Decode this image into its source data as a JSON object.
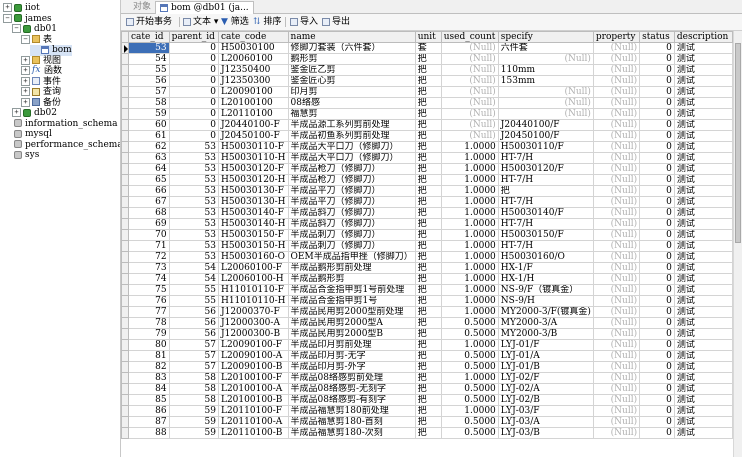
{
  "tree": [
    {
      "label": "iiot",
      "toggle": "⊞",
      "icon": "db",
      "indent": 0,
      "name": "tree-db-iiot"
    },
    {
      "label": "james",
      "toggle": "⊟",
      "icon": "db",
      "indent": 0,
      "name": "tree-db-james"
    },
    {
      "label": "db01",
      "toggle": "⊟",
      "icon": "db",
      "indent": 1,
      "name": "tree-db-db01"
    },
    {
      "label": "表",
      "toggle": "⊟",
      "icon": "folder",
      "indent": 2,
      "name": "tree-tables-folder"
    },
    {
      "label": "bom",
      "toggle": "",
      "icon": "table",
      "indent": 3,
      "name": "tree-table-bom",
      "selected": true
    },
    {
      "label": "视图",
      "toggle": "⊞",
      "icon": "folder",
      "indent": 2,
      "name": "tree-views"
    },
    {
      "label": "函数",
      "toggle": "⊞",
      "icon": "fx",
      "indent": 2,
      "name": "tree-functions"
    },
    {
      "label": "事件",
      "toggle": "⊞",
      "icon": "event",
      "indent": 2,
      "name": "tree-events"
    },
    {
      "label": "查询",
      "toggle": "⊞",
      "icon": "query",
      "indent": 2,
      "name": "tree-queries"
    },
    {
      "label": "备份",
      "toggle": "⊞",
      "icon": "backup",
      "indent": 2,
      "name": "tree-backups"
    },
    {
      "label": "db02",
      "toggle": "⊞",
      "icon": "db",
      "indent": 1,
      "name": "tree-db-db02"
    },
    {
      "label": "information_schema",
      "toggle": "",
      "icon": "dbgray",
      "indent": 0,
      "name": "tree-db-information-schema"
    },
    {
      "label": "mysql",
      "toggle": "",
      "icon": "dbgray",
      "indent": 0,
      "name": "tree-db-mysql"
    },
    {
      "label": "performance_schema",
      "toggle": "",
      "icon": "dbgray",
      "indent": 0,
      "name": "tree-db-performance-schema"
    },
    {
      "label": "sys",
      "toggle": "",
      "icon": "dbgray",
      "indent": 0,
      "name": "tree-db-sys"
    }
  ],
  "tabs": {
    "objects": "对象",
    "bom": "bom @db01 (ja..."
  },
  "toolbar": {
    "begin_transaction": "开始事务",
    "text": "文本",
    "filter": "筛选",
    "sort": "排序",
    "import": "导入",
    "export": "导出"
  },
  "columns": [
    "cate_id",
    "parent_id",
    "cate_code",
    "name",
    "unit",
    "used_count",
    "specify",
    "property",
    "status",
    "description"
  ],
  "null_text": "(Null)",
  "rows": [
    [
      "53",
      "0",
      "H50030100",
      "修脚刀套装（六件套）",
      "套",
      null,
      "六件套",
      null,
      "0",
      "测试"
    ],
    [
      "54",
      "0",
      "L20060100",
      "鹅形剪",
      "把",
      null,
      null,
      null,
      "0",
      "测试"
    ],
    [
      "55",
      "0",
      "J12350400",
      "鉴金匠乙剪",
      "把",
      null,
      "110mm",
      null,
      "0",
      "测试"
    ],
    [
      "56",
      "0",
      "J12350300",
      "鉴金匠心剪",
      "把",
      null,
      "153mm",
      null,
      "0",
      "测试"
    ],
    [
      "57",
      "0",
      "L20090100",
      "印月剪",
      "把",
      null,
      null,
      null,
      "0",
      "测试"
    ],
    [
      "58",
      "0",
      "L20100100",
      "08络感",
      "把",
      null,
      null,
      null,
      "0",
      "测试"
    ],
    [
      "59",
      "0",
      "L20110100",
      "福慧剪",
      "把",
      null,
      null,
      null,
      "0",
      "测试"
    ],
    [
      "60",
      "0",
      "J20440100-F",
      "半成品源工系列剪前处理",
      "把",
      null,
      "J20440100/F",
      null,
      "0",
      "测试"
    ],
    [
      "61",
      "0",
      "J20450100-F",
      "半成品初鱼系列剪前处理",
      "把",
      null,
      "J20450100/F",
      null,
      "0",
      "测试"
    ],
    [
      "62",
      "53",
      "H50030110-F",
      "半成品大平口刀（修脚刀）",
      "把",
      "1.0000",
      "H50030110/F",
      null,
      "0",
      "测试"
    ],
    [
      "63",
      "53",
      "H50030110-H",
      "半成品大平口刀（修脚刀）",
      "把",
      "1.0000",
      "HT-7/H",
      null,
      "0",
      "测试"
    ],
    [
      "64",
      "53",
      "H50030120-F",
      "半成品枪刀（修脚刀）",
      "把",
      "1.0000",
      "H50030120/F",
      null,
      "0",
      "测试"
    ],
    [
      "65",
      "53",
      "H50030120-H",
      "半成品枪刀（修脚刀）",
      "把",
      "1.0000",
      "HT-7/H",
      null,
      "0",
      "测试"
    ],
    [
      "66",
      "53",
      "H50030130-F",
      "半成品平刀（修脚刀）",
      "把",
      "1.0000",
      "把",
      null,
      "0",
      "测试"
    ],
    [
      "67",
      "53",
      "H50030130-H",
      "半成品平刀（修脚刀）",
      "把",
      "1.0000",
      "HT-7/H",
      null,
      "0",
      "测试"
    ],
    [
      "68",
      "53",
      "H50030140-F",
      "半成品斜刀（修脚刀）",
      "把",
      "1.0000",
      "H50030140/F",
      null,
      "0",
      "测试"
    ],
    [
      "69",
      "53",
      "H50030140-H",
      "半成品斜刀（修脚刀）",
      "把",
      "1.0000",
      "HT-7/H",
      null,
      "0",
      "测试"
    ],
    [
      "70",
      "53",
      "H50030150-F",
      "半成品刺刀（修脚刀）",
      "把",
      "1.0000",
      "H50030150/F",
      null,
      "0",
      "测试"
    ],
    [
      "71",
      "53",
      "H50030150-H",
      "半成品刺刀（修脚刀）",
      "把",
      "1.0000",
      "HT-7/H",
      null,
      "0",
      "测试"
    ],
    [
      "72",
      "53",
      "H50030160-O",
      "OEM半成品指甲挫（修脚刀）",
      "把",
      "1.0000",
      "H50030160/O",
      null,
      "0",
      "测试"
    ],
    [
      "73",
      "54",
      "L20060100-F",
      "半成品鹅形剪前处理",
      "把",
      "1.0000",
      "HX-1/F",
      null,
      "0",
      "测试"
    ],
    [
      "74",
      "54",
      "L20060100-H",
      "半成品鹅形剪",
      "把",
      "1.0000",
      "HX-1/H",
      null,
      "0",
      "测试"
    ],
    [
      "75",
      "55",
      "H11010110-F",
      "半成品合金指甲剪1号前处理",
      "把",
      "1.0000",
      "NS-9/F（镀真金）",
      null,
      "0",
      "测试"
    ],
    [
      "76",
      "55",
      "H11010110-H",
      "半成品合金指甲剪1号",
      "把",
      "1.0000",
      "NS-9/H",
      null,
      "0",
      "测试"
    ],
    [
      "77",
      "56",
      "J12000370-F",
      "半成品民用剪2000型前处理",
      "把",
      "1.0000",
      "MY2000-3/F(镀真金)",
      null,
      "0",
      "测试"
    ],
    [
      "78",
      "56",
      "J12000300-A",
      "半成品民用剪2000型A",
      "把",
      "0.5000",
      "MY2000-3/A",
      null,
      "0",
      "测试"
    ],
    [
      "79",
      "56",
      "J12000300-B",
      "半成品民用剪2000型B",
      "把",
      "0.5000",
      "MY2000-3/B",
      null,
      "0",
      "测试"
    ],
    [
      "80",
      "57",
      "L20090100-F",
      "半成品印月剪前处理",
      "把",
      "1.0000",
      "LYJ-01/F",
      null,
      "0",
      "测试"
    ],
    [
      "81",
      "57",
      "L20090100-A",
      "半成品印月剪-无字",
      "把",
      "0.5000",
      "LYJ-01/A",
      null,
      "0",
      "测试"
    ],
    [
      "82",
      "57",
      "L20090100-B",
      "半成品印月剪-外字",
      "把",
      "0.5000",
      "LYJ-01/B",
      null,
      "0",
      "测试"
    ],
    [
      "83",
      "58",
      "L20100100-F",
      "半成品08络感剪前处理",
      "把",
      "1.0000",
      "LYJ-02/F",
      null,
      "0",
      "测试"
    ],
    [
      "84",
      "58",
      "L20100100-A",
      "半成品08络感剪-无刻字",
      "把",
      "0.5000",
      "LYJ-02/A",
      null,
      "0",
      "测试"
    ],
    [
      "85",
      "58",
      "L20100100-B",
      "半成品08络感剪-有刻字",
      "把",
      "0.5000",
      "LYJ-02/B",
      null,
      "0",
      "测试"
    ],
    [
      "86",
      "59",
      "L20110100-F",
      "半成品福慧剪180前处理",
      "把",
      "1.0000",
      "LYJ-03/F",
      null,
      "0",
      "测试"
    ],
    [
      "87",
      "59",
      "L20110100-A",
      "半成品福慧剪180-首刻",
      "把",
      "0.5000",
      "LYJ-03/A",
      null,
      "0",
      "测试"
    ],
    [
      "88",
      "59",
      "L20110100-B",
      "半成品福慧剪180-次刻",
      "把",
      "0.5000",
      "LYJ-03/B",
      null,
      "0",
      "测试"
    ]
  ]
}
